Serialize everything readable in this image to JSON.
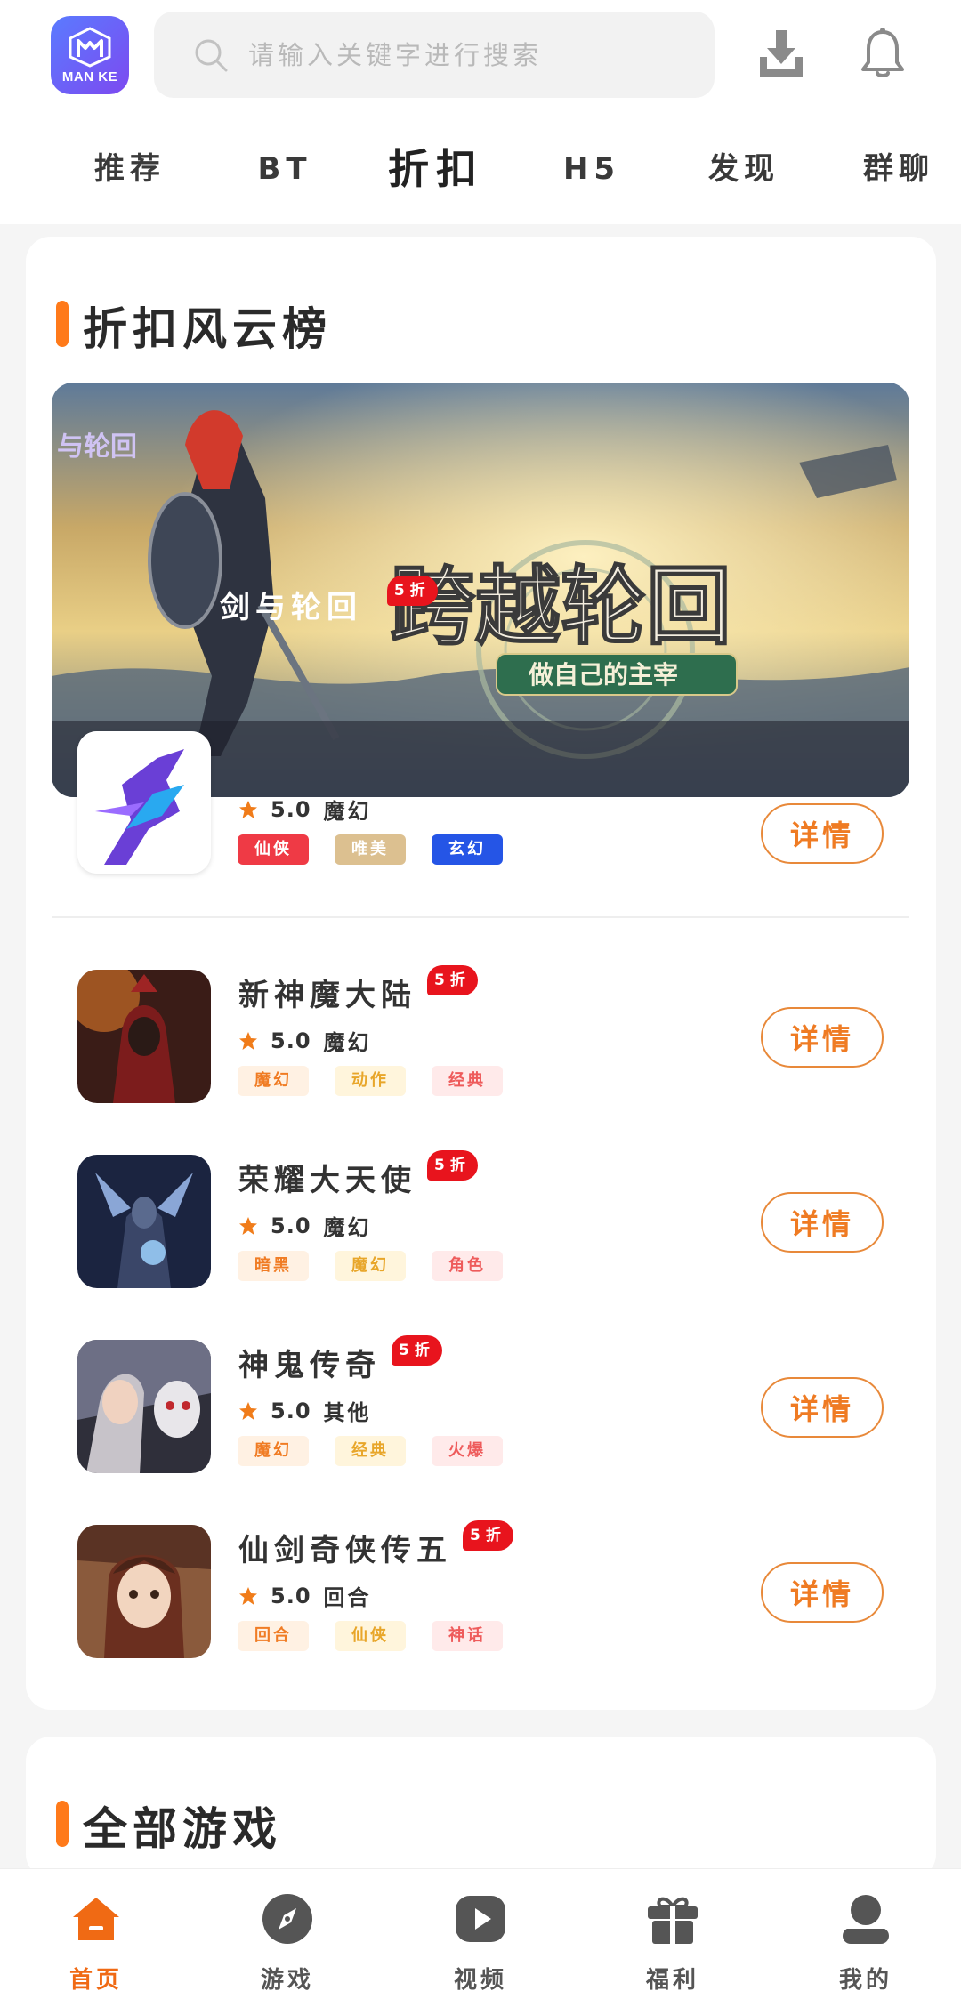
{
  "header": {
    "logo_text": "MAN KE",
    "search_placeholder": "请输入关键字进行搜索",
    "icons": [
      "download-icon",
      "bell-icon"
    ]
  },
  "tabs": [
    {
      "label": "推荐",
      "active": false
    },
    {
      "label": "BT",
      "active": false
    },
    {
      "label": "折扣",
      "active": true
    },
    {
      "label": "H5",
      "active": false
    },
    {
      "label": "发现",
      "active": false
    },
    {
      "label": "群聊",
      "active": false
    }
  ],
  "ranking": {
    "title": "折扣风云榜",
    "accent_color": "#ff7a1a",
    "featured": {
      "banner_title": "跨越轮回",
      "banner_subtitle": "做自己的主宰",
      "banner_logo": "与轮回",
      "name": "剑与轮回",
      "discount": "5折",
      "rating": "5.0",
      "genre": "魔幻",
      "tags": [
        "仙侠",
        "唯美",
        "玄幻"
      ],
      "detail_label": "详情"
    },
    "games": [
      {
        "name": "新神魔大陆",
        "discount": "5折",
        "rating": "5.0",
        "genre": "魔幻",
        "tags": [
          "魔幻",
          "动作",
          "经典"
        ],
        "detail_label": "详情"
      },
      {
        "name": "荣耀大天使",
        "discount": "5折",
        "rating": "5.0",
        "genre": "魔幻",
        "tags": [
          "暗黑",
          "魔幻",
          "角色"
        ],
        "detail_label": "详情"
      },
      {
        "name": "神鬼传奇",
        "discount": "5折",
        "rating": "5.0",
        "genre": "其他",
        "tags": [
          "魔幻",
          "经典",
          "火爆"
        ],
        "detail_label": "详情"
      },
      {
        "name": "仙剑奇侠传五",
        "discount": "5折",
        "rating": "5.0",
        "genre": "回合",
        "tags": [
          "回合",
          "仙侠",
          "神话"
        ],
        "detail_label": "详情"
      }
    ]
  },
  "all_games": {
    "title": "全部游戏"
  },
  "bottom_nav": [
    {
      "label": "首页",
      "icon": "home-icon",
      "active": true
    },
    {
      "label": "游戏",
      "icon": "compass-icon",
      "active": false
    },
    {
      "label": "视频",
      "icon": "play-icon",
      "active": false
    },
    {
      "label": "福利",
      "icon": "gift-icon",
      "active": false
    },
    {
      "label": "我的",
      "icon": "user-icon",
      "active": false
    }
  ],
  "colors": {
    "active_nav": "#f06a14",
    "detail_button": "#ef7b23",
    "discount_badge": "#e8141d"
  }
}
